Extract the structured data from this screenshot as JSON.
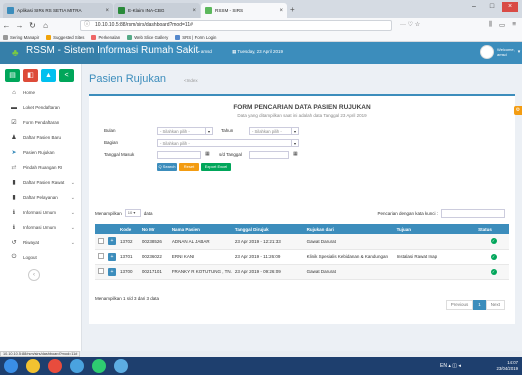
{
  "browser": {
    "tabs": [
      {
        "label": "Aplikasi SIRs RS SETIA MITRA"
      },
      {
        "label": "E-Klaim INA-CBG"
      },
      {
        "label": "RSSM - SIRS"
      }
    ],
    "url": "10.10.10.5:88/rsm/sirs/dashboard?mod=11#",
    "bookmarks": [
      "Sering Manapir",
      "Suggested Sites",
      "Perkenalan",
      "Web Slice Gallery",
      "SRS | Form Login"
    ]
  },
  "app": {
    "title": "RSSM - Sistem Informasi Rumah Sakit",
    "user_short": "amsd",
    "date": "Tuesday, 23 April 2019",
    "welcome": "Welcome,",
    "username": "amsd"
  },
  "sidebar": {
    "items": [
      {
        "label": "Home",
        "icon": "home-icon"
      },
      {
        "label": "Loket Pendaftaran",
        "icon": "desk-icon"
      },
      {
        "label": "Form Pendaftaran",
        "icon": "form-icon"
      },
      {
        "label": "Daftar Pasien Baru",
        "icon": "user-icon"
      },
      {
        "label": "Pasien Rujukan",
        "icon": "ambulance-icon"
      },
      {
        "label": "Pindah Ruangan RI",
        "icon": "transfer-icon"
      },
      {
        "label": "Daftar Pasien Rawat",
        "icon": "bed-icon"
      },
      {
        "label": "Daftar Pelayanan",
        "icon": "lock-icon"
      },
      {
        "label": "Informasi Umum",
        "icon": "info-icon"
      },
      {
        "label": "Informasi Umum",
        "icon": "info-icon"
      },
      {
        "label": "Riwayat",
        "icon": "history-icon"
      },
      {
        "label": "Logout",
        "icon": "power-icon"
      }
    ]
  },
  "page": {
    "title": "Pasien Rujukan",
    "subtitle": "<Index"
  },
  "form": {
    "title": "FORM PENCARIAN DATA PASIEN RUJUKAN",
    "subtitle": "Data yang ditampilkan saat ini adalah data Tanggal 23 April 2019",
    "bulan_label": "Bulan",
    "bulan_value": "- Silahkan pilih -",
    "tahun_label": "Tahun",
    "tahun_value": "- Silahkan pilih -",
    "bagian_label": "Bagian",
    "bagian_value": "- Silahkan pilih -",
    "tanggal_label": "Tanggal Masuk",
    "sd_label": "s/d Tanggal",
    "btn_search": "Q Search",
    "btn_reset": "Reset",
    "btn_export": "Export Excel"
  },
  "table": {
    "show_label": "Menampilkan",
    "show_value": "10",
    "show_suffix": "data",
    "search_label": "Pencarian dengan kata kunci :",
    "headers": [
      "",
      "",
      "Kode",
      "No Mr",
      "Nama Pasien",
      "Tanggal Dirujuk",
      "Rujukan dari",
      "Tujuan",
      "Status"
    ],
    "rows": [
      {
        "kode": "13702",
        "nomr": "00238526",
        "nama": "ADNAN AL JABAR",
        "tanggal": "23 Apr 2019 - 12:21:33",
        "dari": "Gawat Darurat",
        "tujuan": ""
      },
      {
        "kode": "13701",
        "nomr": "00236022",
        "nama": "ERNI KANI",
        "tanggal": "23 Apr 2019 - 11:26:09",
        "dari": "Klinik Spesialis Kebidanan & Kandungan",
        "tujuan": "Instalasi Rawat Inap"
      },
      {
        "kode": "13700",
        "nomr": "00217101",
        "nama": "FRANKY R KOTUTUNG , TN.",
        "tanggal": "23 Apr 2019 - 09:26:09",
        "dari": "Gawat Darurat",
        "tujuan": ""
      }
    ],
    "info": "Menampilkan 1 s/d 3 dari 3 data",
    "pager": {
      "prev": "Previous",
      "current": "1",
      "next": "Next"
    }
  },
  "statusbar": {
    "url": "10.10.10.5:88/rsm/sirs/dashboard?mod=11#"
  },
  "taskbar": {
    "time": "14:07",
    "date": "23/04/2019"
  },
  "colors": {
    "primary": "#3c8dbc",
    "success": "#00a65a",
    "warning": "#f39c12",
    "danger": "#dd4b39"
  }
}
